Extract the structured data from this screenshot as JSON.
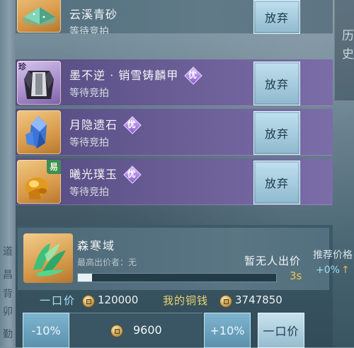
{
  "items": [
    {
      "name": "云溪青砂",
      "status": "等待竞拍",
      "badge": "",
      "corner_tag": "",
      "style": "normal",
      "icon": "green-crystal-icon"
    },
    {
      "name": "墨不逆 · 销雪铸麟甲",
      "status": "等待竞拍",
      "badge": "优",
      "corner_tag": "珍",
      "style": "rare",
      "icon": "armor-icon"
    },
    {
      "name": "月隐遗石",
      "status": "等待竞拍",
      "badge": "优",
      "corner_tag": "",
      "style": "rare",
      "icon": "blue-crystal-icon"
    },
    {
      "name": "曦光璞玉",
      "status": "等待竞拍",
      "badge": "优",
      "corner_tag": "易",
      "style": "rare",
      "icon": "golden-jade-icon"
    }
  ],
  "give_up_label": "放弃",
  "history_panel": {
    "text": "历史"
  },
  "left_strip_glyphs": [
    "道",
    "昌",
    "背",
    "卯",
    "勤"
  ],
  "selected": {
    "name": "森寒域",
    "top_bidder": "最高出价者：无",
    "no_bid_text": "暂无人出价",
    "timer": "3s",
    "progress": 0.07
  },
  "buyout": {
    "label": "一口价",
    "value": "120000"
  },
  "my_money": {
    "label": "我的铜钱",
    "value": "3747850"
  },
  "price_controls": {
    "minus": "-10%",
    "price": "9600",
    "plus": "+10%",
    "buyout_button": "一口价"
  },
  "reference": {
    "label": "推荐价格",
    "change": "+0%"
  },
  "colors": {
    "timer": "#f0c34a",
    "buyout_label": "#a9e4f3",
    "my_money_label": "#e8d470"
  }
}
